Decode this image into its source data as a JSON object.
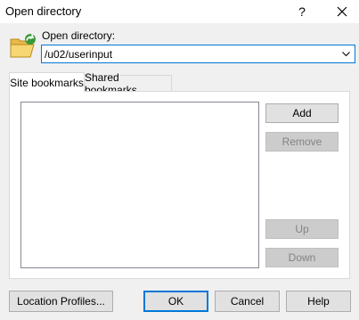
{
  "window": {
    "title": "Open directory",
    "help_label": "?",
    "close_icon": "close-icon"
  },
  "path": {
    "label": "Open directory:",
    "value": "/u02/userinput",
    "folder_icon": "open-folder-icon",
    "dropdown_icon": "chevron-down-icon"
  },
  "tabs": [
    {
      "label": "Site bookmarks",
      "active": true
    },
    {
      "label": "Shared bookmarks",
      "active": false
    }
  ],
  "bookmarks": {
    "items": [],
    "add_label": "Add",
    "remove_label": "Remove",
    "up_label": "Up",
    "down_label": "Down"
  },
  "footer": {
    "location_profiles_label": "Location Profiles...",
    "ok_label": "OK",
    "cancel_label": "Cancel",
    "help_label": "Help"
  },
  "colors": {
    "accent": "#0078d7",
    "dialog_bg": "#f0f0f0",
    "button_bg": "#e1e1e1",
    "disabled_text": "#838383"
  }
}
